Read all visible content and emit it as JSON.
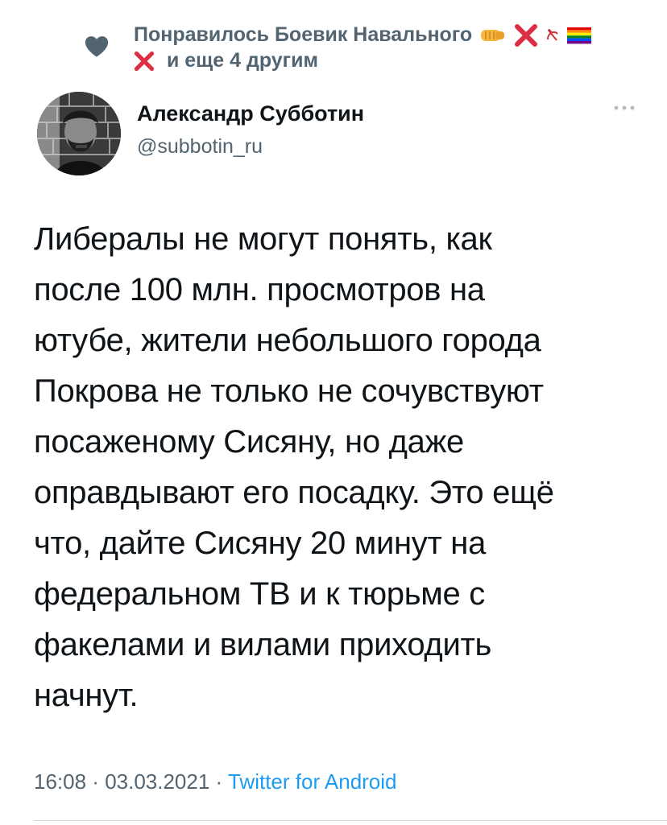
{
  "social_context": {
    "liked_prefix": "Понравилось Боевик Навального",
    "liked_suffix": "и еще 4 другим",
    "emojis": [
      "fist-emoji",
      "cross-mark-emoji",
      "hammer-sickle-emoji",
      "rainbow-flag-emoji",
      "cross-mark-emoji"
    ]
  },
  "author": {
    "name": "Александр Субботин",
    "handle": "@subbotin_ru"
  },
  "tweet": {
    "text": "Либералы не могут понять, как\nпосле 100 млн. просмотров на\nютубе, жители небольшого города\nПокрова не только не сочувствуют\nпосаженому Сисяну, но даже\nоправдывают его посадку. Это ещё\nчто, дайте Сисяну 20 минут на\nфедеральном ТВ и к тюрьме с\nфакелами и вилами приходить\nначнут."
  },
  "meta": {
    "time": "16:08",
    "separator1": " · ",
    "date": "03.03.2021",
    "separator2": " · ",
    "source": "Twitter for Android"
  },
  "colors": {
    "secondary_text": "#536471",
    "link": "#1d9bf0",
    "primary_text": "#0f1419"
  }
}
